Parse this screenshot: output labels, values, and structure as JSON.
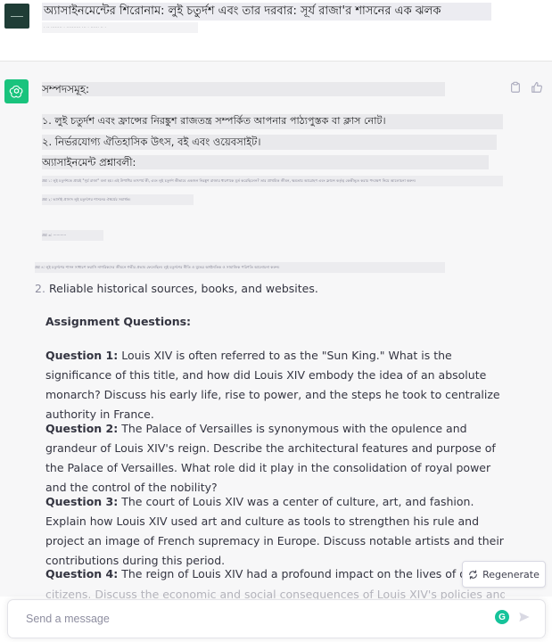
{
  "user_message": {
    "title": "অ্যাসাইনমেন্টের শিরোনাম: লুই চতুর্দশ এবং তার দরবার: সূর্য রাজা'র শাসনের এক ঝলক",
    "subtitle": "· ·· ········ · ·········· ··· · ······ ·· ·"
  },
  "assistant": {
    "bn_resources_heading": "সম্পদসমূহ:",
    "bn_resource_1": "১. লুই চতুর্দশ এবং ফ্রান্সের নিরঙ্কুশ রাজতন্ত্র সম্পর্কিত আপনার পাঠ্যপুস্তক বা ক্লাস নোট।",
    "bn_resource_2": "২. নির্ভরযোগ্য ঐতিহাসিক উৎস, বই এবং ওয়েবসাইট।",
    "bn_questions_heading": "অ্যাসাইনমেন্ট প্রশ্নাবলী:",
    "bn_tiny_1": "প্রশ্ন ১: লুই চতুর্দশকে প্রায়ই \"সূর্য রাজা\" বলা হয়। এই উপাধির তাৎপর্য কী, এবং লুই চতুর্দশ কীভাবে একজন নিরঙ্কুশ রাজার ধারণাকে মূর্ত করেছিলেন? তার প্রাথমিক জীবন, ক্ষমতায় আরোহণ এবং ফ্রান্সে কর্তৃত্ব কেন্দ্রীভূত করার পদক্ষেপ নিয়ে আলোচনা করুন।",
    "bn_tiny_2": "প্রশ্ন ২: ভার্সাই প্রাসাদ লুই চতুর্দশের শাসনের ঐশ্বর্যের সমার্থক।",
    "bn_tiny_3": "প্রশ্ন ৩: ···········",
    "bn_tiny_4": "প্রশ্ন ৪: লুই চতুর্দশের শাসন সাধারণ ফরাসি নাগরিকদের জীবনে গভীর প্রভাব ফেলেছিল। লুই চতুর্দশের নীতি ও যুদ্ধের অর্থনৈতিক ও সামাজিক পরিণতি আলোচনা করুন।",
    "en_item_num": "2.",
    "en_item_text": "Reliable historical sources, books, and websites.",
    "en_questions_heading": "Assignment Questions:",
    "questions": [
      {
        "label": "Question 1:",
        "text": " Louis XIV is often referred to as the \"Sun King.\" What is the significance of this title, and how did Louis XIV embody the idea of an absolute monarch? Discuss his early life, rise to power, and the steps he took to centralize authority in France."
      },
      {
        "label": "Question 2:",
        "text": " The Palace of Versailles is synonymous with the opulence and grandeur of Louis XIV's reign. Describe the architectural features and purpose of the Palace of Versailles. What role did it play in the consolidation of royal power and the control of the nobility?"
      },
      {
        "label": "Question 3:",
        "text": " The court of Louis XIV was a center of culture, art, and fashion. Explain how Louis XIV used art and culture as tools to strengthen his rule and project an image of French supremacy in Europe. Discuss notable artists and their contributions during this period."
      },
      {
        "label": "Question 4:",
        "text": " The reign of Louis XIV had a profound impact on the lives of ordinary French"
      }
    ],
    "faded_line": "citizens. Discuss the economic and social consequences of Louis XIV's policies and wars on"
  },
  "regenerate_label": "Regenerate",
  "input": {
    "placeholder": "Send a message",
    "value": ""
  },
  "grammarly_letter": "G",
  "icons": {
    "user_avatar": "user-avatar-icon",
    "assistant_avatar": "openai-logo-icon",
    "copy": "clipboard-icon",
    "thumbs_up": "thumbs-up-icon",
    "regenerate": "refresh-icon",
    "send": "send-arrow-icon"
  },
  "colors": {
    "assistant_accent": "#19c37d",
    "user_avatar_bg": "#1f3d36",
    "grammarly": "#15c39a"
  }
}
